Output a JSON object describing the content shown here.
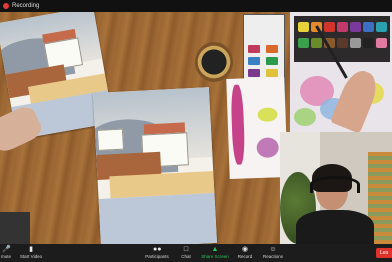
{
  "topbar": {
    "recording_label": "Recording"
  },
  "toolbar": {
    "items": [
      {
        "label": "mute",
        "icon": "microphone-icon"
      },
      {
        "label": "Start Video",
        "icon": "video-camera-icon"
      },
      {
        "label": "Participants",
        "icon": "participants-icon"
      },
      {
        "label": "Chat",
        "icon": "chat-icon"
      },
      {
        "label": "Share Screen",
        "icon": "share-screen-icon"
      },
      {
        "label": "Record",
        "icon": "record-icon"
      },
      {
        "label": "Reactions",
        "icon": "reactions-icon"
      }
    ],
    "leave_label": "Lea"
  },
  "colors": {
    "share_accent": "#29c25c",
    "leave": "#e0312b",
    "toolbar_bg": "#1c1c1c"
  }
}
